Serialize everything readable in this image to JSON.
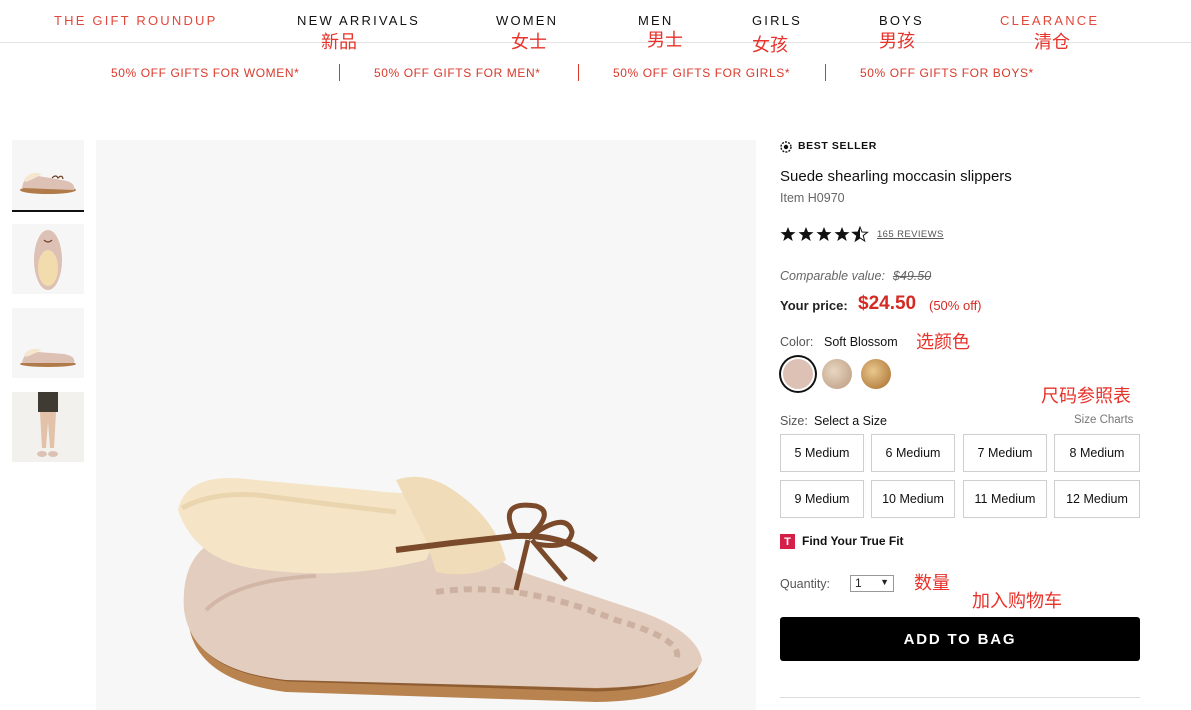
{
  "nav": {
    "items": [
      {
        "label": "THE GIFT ROUNDUP",
        "note": ""
      },
      {
        "label": "NEW ARRIVALS",
        "note": "新品"
      },
      {
        "label": "WOMEN",
        "note": "女士"
      },
      {
        "label": "MEN",
        "note": "男士"
      },
      {
        "label": "GIRLS",
        "note": "女孩"
      },
      {
        "label": "BOYS",
        "note": "男孩"
      },
      {
        "label": "CLEARANCE",
        "note": "清仓"
      }
    ]
  },
  "promos": [
    "50% OFF GIFTS FOR WOMEN*",
    "50% OFF GIFTS FOR MEN*",
    "50% OFF GIFTS FOR GIRLS*",
    "50% OFF GIFTS FOR BOYS*"
  ],
  "product": {
    "badge": "BEST SELLER",
    "title": "Suede shearling moccasin slippers",
    "item_number": "Item H0970",
    "rating": 4.5,
    "reviews": "165 REVIEWS",
    "comparable_label": "Comparable value:",
    "comparable_price": "$49.50",
    "your_price_label": "Your price:",
    "price": "$24.50",
    "discount": "(50% off)",
    "color_label": "Color:",
    "color_value": "Soft Blossom",
    "swatches": [
      "#dcc1b4",
      "#cdb49c",
      "#c28a44"
    ],
    "size_label": "Size:",
    "size_value": "Select a Size",
    "size_charts": "Size Charts",
    "sizes": [
      "5 Medium",
      "6 Medium",
      "7 Medium",
      "8 Medium",
      "9 Medium",
      "10 Medium",
      "11 Medium",
      "12 Medium"
    ],
    "true_fit_icon": "T",
    "true_fit": "Find Your True Fit",
    "quantity_label": "Quantity:",
    "quantity": "1",
    "add_to_bag": "ADD TO BAG"
  },
  "annotations": {
    "color": "选颜色",
    "size_chart": "尺码参照表",
    "quantity": "数量",
    "add_to_cart": "加入购物车"
  },
  "colors": {
    "brand_red": "#e2483b",
    "price_red": "#d52a23",
    "annotation_red": "#e8322a",
    "button": "#000000"
  }
}
